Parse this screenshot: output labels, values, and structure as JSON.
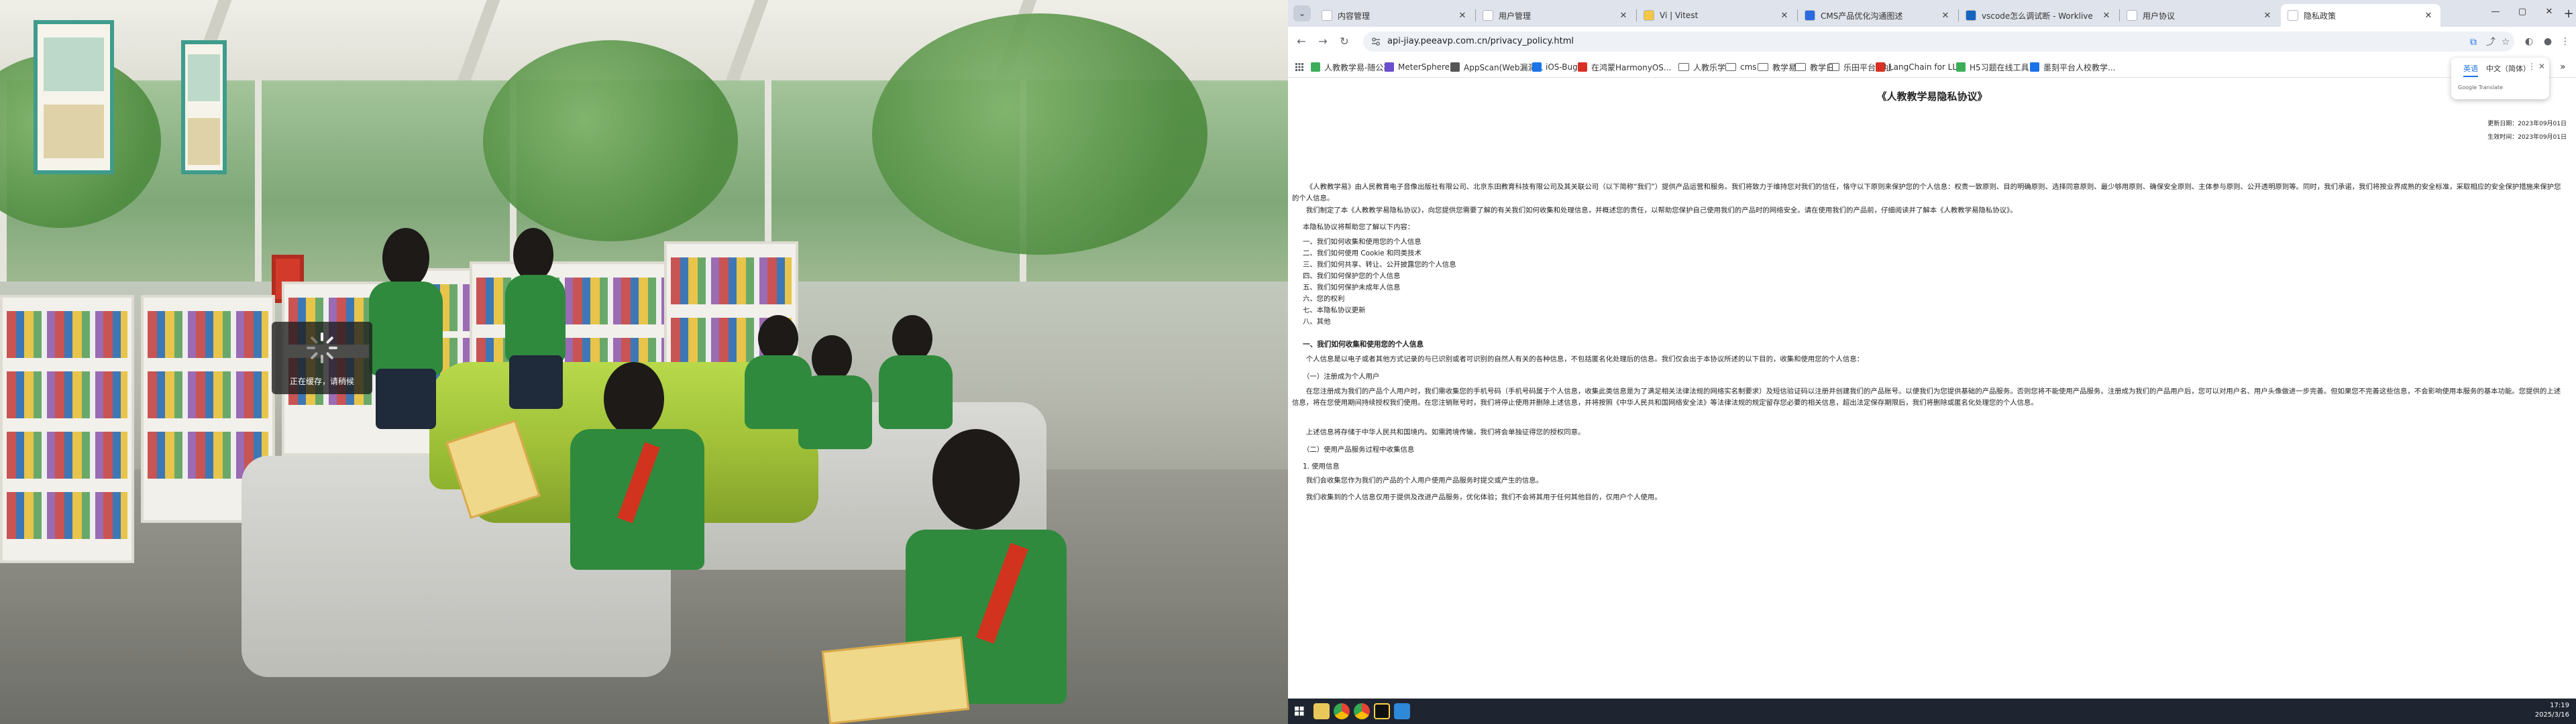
{
  "loading": {
    "text": "正在缓存，请稍候"
  },
  "browser": {
    "tabs": [
      {
        "title": "内容管理",
        "favicon_color": "#ffffff",
        "active": false
      },
      {
        "title": "用户管理",
        "favicon_color": "#ffffff",
        "active": false
      },
      {
        "title": "Vi | Vitest",
        "favicon_color": "#f6c742",
        "active": false
      },
      {
        "title": "CMS产品优化沟通图述",
        "favicon_color": "#2a6ae0",
        "active": false
      },
      {
        "title": "vscode怎么调试断 - Worklive",
        "favicon_color": "#1565c0",
        "active": false
      },
      {
        "title": "用户协议",
        "favicon_color": "#ffffff",
        "active": false
      },
      {
        "title": "隐私政策",
        "favicon_color": "#ffffff",
        "active": true
      }
    ],
    "url": "api-jiay.peeavp.com.cn/privacy_policy.html",
    "bookmarks": [
      {
        "label": "人教教学易-随公苑",
        "kind": "site",
        "color": "#3cae5a"
      },
      {
        "label": "MeterSphere",
        "kind": "site",
        "color": "#6a4fcf"
      },
      {
        "label": "AppScan(Web漏洞...",
        "kind": "site",
        "color": "#555"
      },
      {
        "label": "iOS-Bugly",
        "kind": "site",
        "color": "#1a73e8"
      },
      {
        "label": "在鸿蒙HarmonyOS...",
        "kind": "site",
        "color": "#d93025"
      },
      {
        "label": "人教乐学",
        "kind": "folder"
      },
      {
        "label": "cms",
        "kind": "folder"
      },
      {
        "label": "教学易",
        "kind": "folder"
      },
      {
        "label": "教学日",
        "kind": "folder"
      },
      {
        "label": "乐田平台网址",
        "kind": "folder"
      },
      {
        "label": "LangChain for LL...",
        "kind": "site",
        "color": "#d93025"
      },
      {
        "label": "H5习题在线工具",
        "kind": "site",
        "color": "#3cae5a"
      },
      {
        "label": "墨刻平台人校教学...",
        "kind": "site",
        "color": "#1a73e8"
      }
    ],
    "translate": {
      "lang1": "英语",
      "lang2": "中文（简体）",
      "brand": "Google Translate"
    },
    "window_controls": [
      "—",
      "▢",
      "✕"
    ]
  },
  "doc": {
    "title": "《人教教学易隐私协议》",
    "updated": "更新日期：2023年09月01日",
    "effective": "生效时间：2023年09月01日",
    "intro1": "《人教教学易》由人民教育电子音像出版社有限公司、北京东田教育科技有限公司及其关联公司（以下简称“我们”）提供产品运营和服务。我们将致力于维持您对我们的信任，恪守以下原则来保护您的个人信息：权责一致原则、目的明确原则、选择同意原则、最少够用原则、确保安全原则、主体参与原则、公开透明原则等。同时，我们承诺，我们将按业界成熟的安全标准，采取相应的安全保护措施来保护您的个人信息。",
    "intro2": "我们制定了本《人教教学易隐私协议》，向您提供您需要了解的有关我们如何收集和处理信息，并概述您的责任，以帮助您保护自己使用我们的产品时的网络安全。请在使用我们的产品前，仔细阅读并了解本《人教教学易隐私协议》。",
    "toc_intro": "本隐私协议将帮助您了解以下内容：",
    "toc": [
      "一、我们如何收集和使用您的个人信息",
      "二、我们如何使用 Cookie 和同类技术",
      "三、我们如何共享、转让、公开披露您的个人信息",
      "四、我们如何保护您的个人信息",
      "五、我们如何保护未成年人信息",
      "六、您的权利",
      "七、本隐私协议更新",
      "八、其他"
    ],
    "s1_title": "一、我们如何收集和使用您的个人信息",
    "s1_p1": "个人信息是以电子或者其他方式记录的与已识别或者可识别的自然人有关的各种信息，不包括匿名化处理后的信息。我们仅会出于本协议所述的以下目的，收集和使用您的个人信息：",
    "s1_sub1": "（一）注册成为个人用户",
    "s1_p2": "在您注册成为我们的产品个人用户时，我们需收集您的手机号码（手机号码属于个人信息，收集此类信息是为了满足相关法律法规的网络实名制要求）及短信验证码以注册并创建我们的产品账号。以便我们为您提供基础的产品服务。否则您将不能使用产品服务。注册成为我们的产品用户后，您可以对用户名、用户头像做进一步完善。但如果您不完善这些信息，不会影响使用本服务的基本功能。您提供的上述信息，将在您使用期间持续授权我们使用。在您注销账号时，我们将停止使用并删除上述信息，并将按照《中华人民共和国网络安全法》等法律法规的规定留存您必要的相关信息，超出法定保存期限后，我们将删除或匿名化处理您的个人信息。",
    "s1_p3": "上述信息将存储于中华人民共和国境内。如需跨境传输，我们将会单独征得您的授权同意。",
    "s1_sub2": "（二）使用产品服务过程中收集信息",
    "s1_sub3": "1. 使用信息",
    "s1_p4": "我们会收集您作为我们的产品的个人用户使用产品服务时提交或产生的信息。",
    "s1_p5": "我们收集到的个人信息仅用于提供及改进产品服务，优化体验；我们不会将其用于任何其他目的，仅用户个人使用。"
  },
  "taskbar": {
    "time": "17:19",
    "date": "2025/3/16"
  }
}
